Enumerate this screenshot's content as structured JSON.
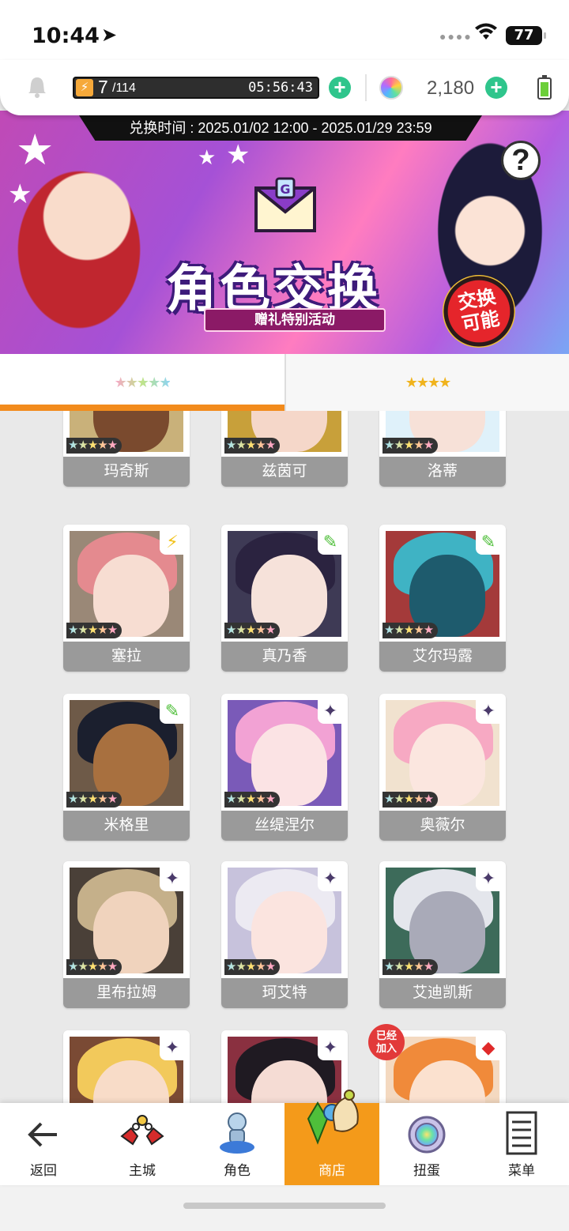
{
  "status_bar": {
    "time": "10:44",
    "battery": "77"
  },
  "resources": {
    "stamina_current": "7",
    "stamina_max": "/114",
    "stamina_timer": "05:56:43",
    "gems": "2,180"
  },
  "banner": {
    "exchange_time": "兑换时间 : 2025.01/02 12:00 - 2025.01/29 23:59",
    "title": "角色交换",
    "subtitle": "赠礼特别活动",
    "badge_line1": "交换",
    "badge_line2": "可能",
    "help": "?"
  },
  "tabs": [
    {
      "label": "★★★★★"
    },
    {
      "label": "★★★★"
    }
  ],
  "cards": [
    {
      "name": "玛奇斯",
      "stars": "★★★★★",
      "elem": "",
      "hair": "#3b3a2e",
      "face": "#7a4a2e",
      "bg": "#c9b17a"
    },
    {
      "name": "兹茵可",
      "stars": "★★★★★",
      "elem": "",
      "hair": "#8b5fc8",
      "face": "#f5d7c9",
      "bg": "#c8a03a"
    },
    {
      "name": "洛蒂",
      "stars": "★★★★★",
      "elem": "",
      "hair": "#9cd4ef",
      "face": "#f7e1d8",
      "bg": "#dff1fa"
    },
    {
      "name": "塞拉",
      "stars": "★★★★★",
      "elem": "⚡",
      "hair": "#e48a8f",
      "face": "#f7ddd2",
      "bg": "#9a8877"
    },
    {
      "name": "真乃香",
      "stars": "★★★★★",
      "elem": "✎",
      "hair": "#2b2340",
      "face": "#f6e2da",
      "bg": "#3e3a55"
    },
    {
      "name": "艾尔玛露",
      "stars": "★★★★★",
      "elem": "✎",
      "hair": "#3fb3c4",
      "face": "#1e5b6d",
      "bg": "#a43a3a"
    },
    {
      "name": "米格里",
      "stars": "★★★★★",
      "elem": "✎",
      "hair": "#1b1f2e",
      "face": "#a8703f",
      "bg": "#6e5a48"
    },
    {
      "name": "丝缇涅尔",
      "stars": "★★★★★",
      "elem": "✦",
      "hair": "#f2a2d4",
      "face": "#fbe3e4",
      "bg": "#7a5ab8"
    },
    {
      "name": "奥薇尔",
      "stars": "★★★★★",
      "elem": "✦",
      "hair": "#f7a9c3",
      "face": "#fbe6df",
      "bg": "#f1e2cf"
    },
    {
      "name": "里布拉姆",
      "stars": "★★★★★",
      "elem": "✦",
      "hair": "#c5b08a",
      "face": "#f0d3bd",
      "bg": "#4a4038"
    },
    {
      "name": "珂艾特",
      "stars": "★★★★★",
      "elem": "✦",
      "hair": "#eceaf2",
      "face": "#fbe4df",
      "bg": "#c7c2dc"
    },
    {
      "name": "艾迪凯斯",
      "stars": "★★★★★",
      "elem": "✦",
      "hair": "#e4e6ec",
      "face": "#a9aab8",
      "bg": "#3d6b5a"
    },
    {
      "name": "",
      "stars": "",
      "elem": "✦",
      "hair": "#f2c95b",
      "face": "#f8dcc8",
      "bg": "#7a4a34"
    },
    {
      "name": "",
      "stars": "",
      "elem": "✦",
      "hair": "#1f1a22",
      "face": "#f5dcd4",
      "bg": "#8a3040"
    },
    {
      "name": "",
      "stars": "",
      "elem": "◆",
      "hair": "#f08a3a",
      "face": "#fbe1cf",
      "bg": "#f4d9c0",
      "joined": "已经\n加入"
    }
  ],
  "nav": {
    "back": "返回",
    "items": [
      {
        "label": "主城",
        "icon": "castle-icon"
      },
      {
        "label": "角色",
        "icon": "character-icon"
      },
      {
        "label": "商店",
        "icon": "shop-icon"
      },
      {
        "label": "扭蛋",
        "icon": "gacha-icon"
      },
      {
        "label": "菜单",
        "icon": "menu-icon"
      }
    ]
  }
}
